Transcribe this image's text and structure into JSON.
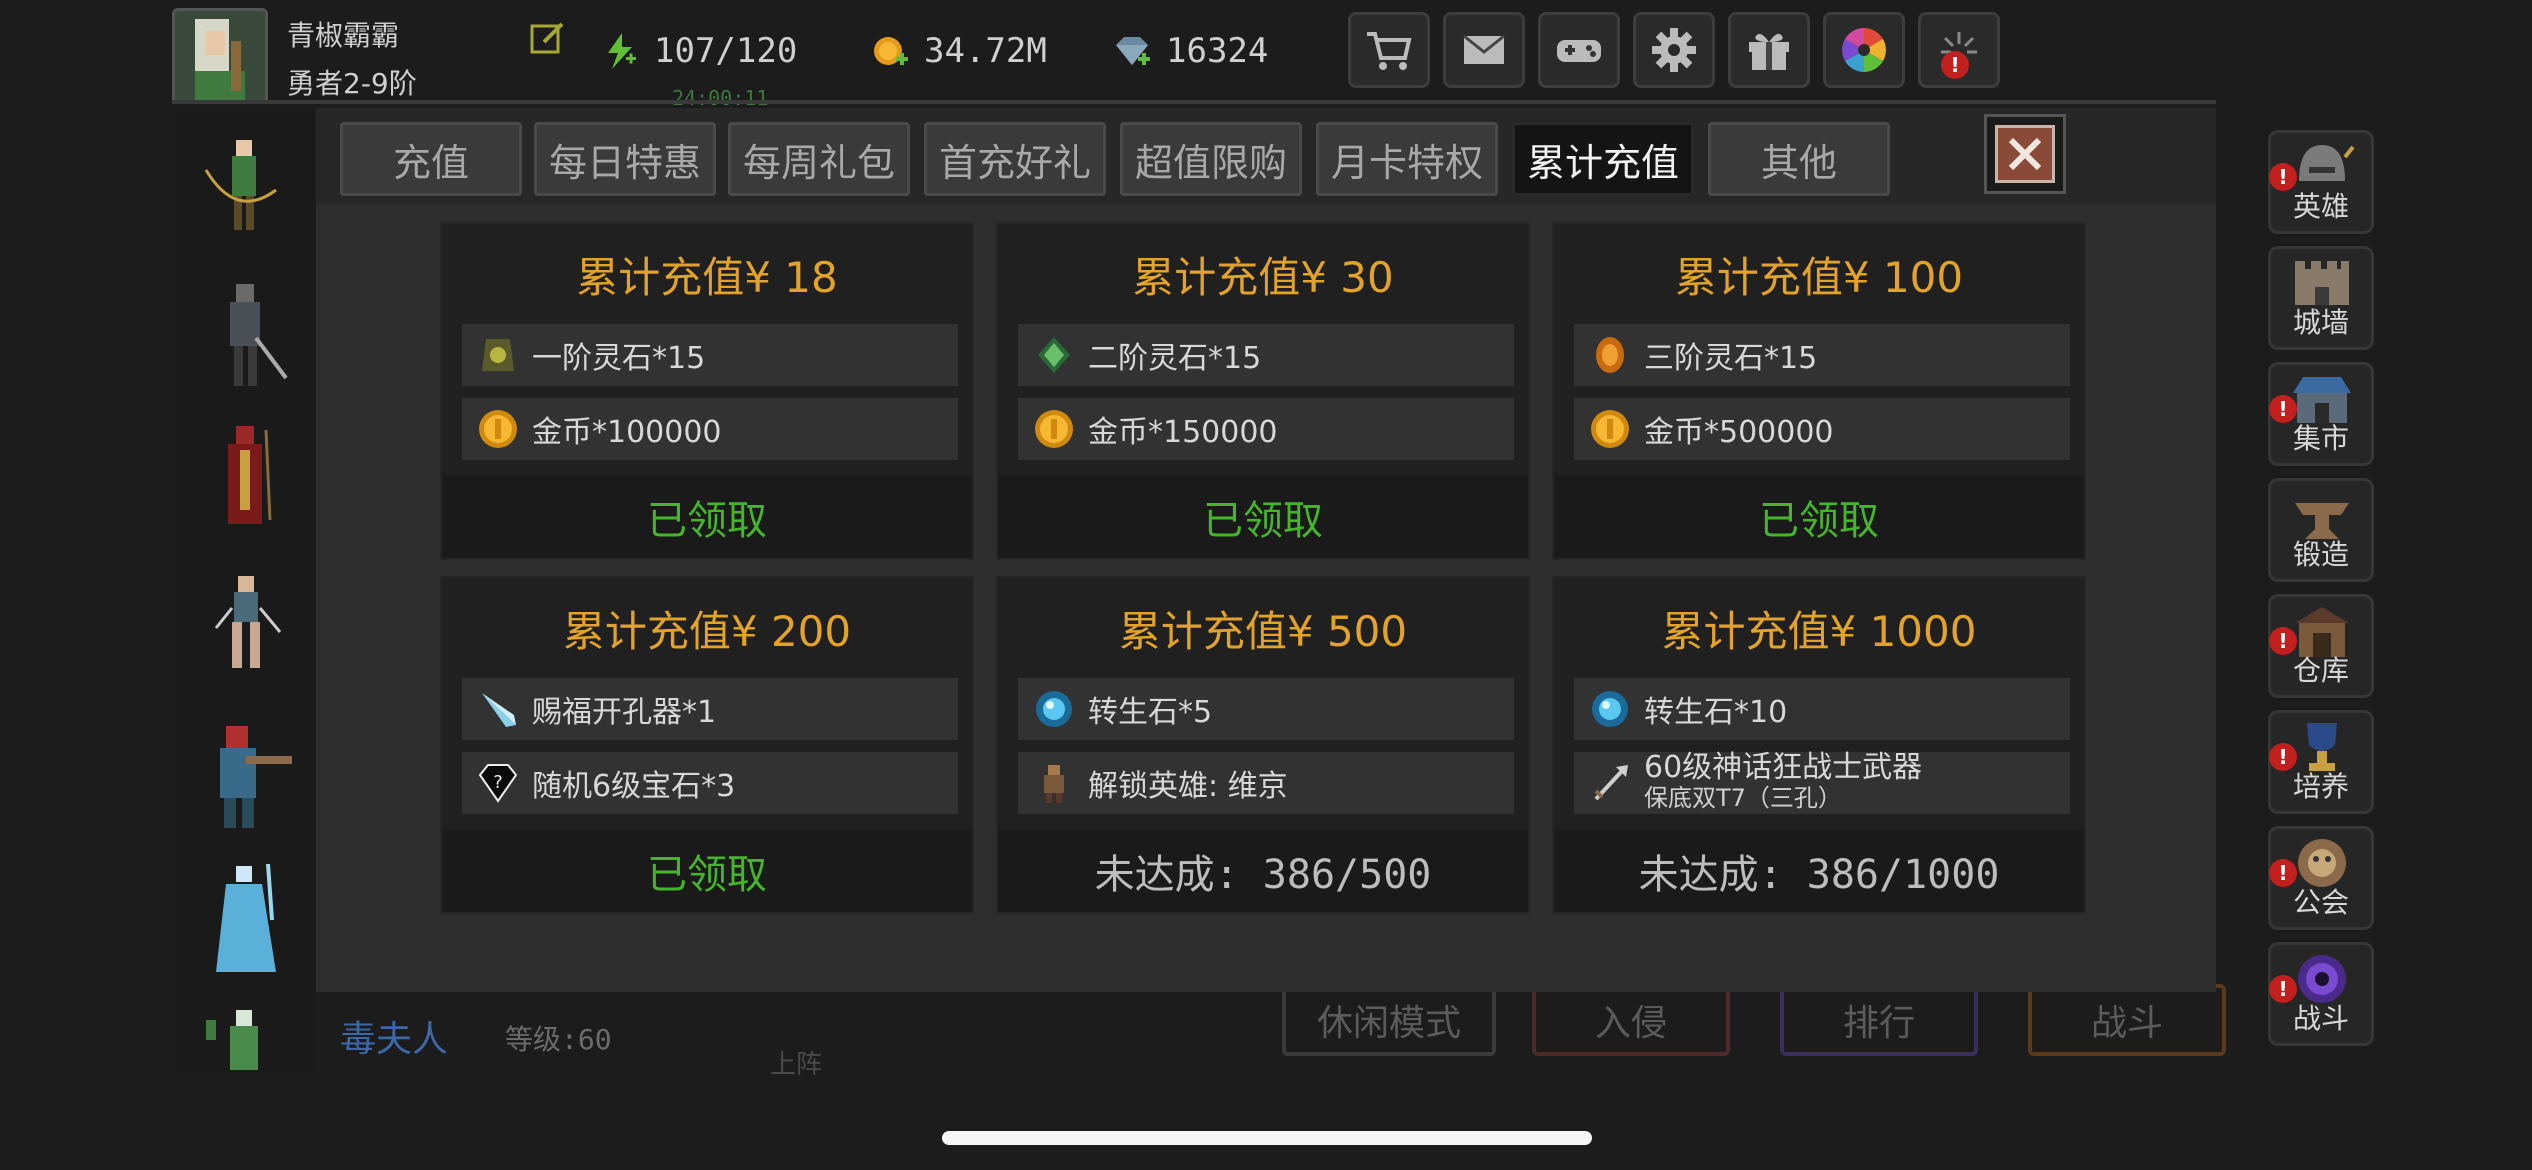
{
  "player": {
    "name": "青椒霸霸",
    "rank": "勇者2-9阶"
  },
  "resources": {
    "energy": "107/120",
    "energy_timer": "24:00:11",
    "gold": "34.72M",
    "gems": "16324"
  },
  "top_buttons": [
    {
      "name": "shop",
      "icon": "cart-icon"
    },
    {
      "name": "mail",
      "icon": "envelope-icon"
    },
    {
      "name": "gamepad",
      "icon": "gamepad-icon"
    },
    {
      "name": "settings",
      "icon": "gear-icon"
    },
    {
      "name": "gift",
      "icon": "gift-icon"
    },
    {
      "name": "wheel",
      "icon": "color-wheel-icon"
    },
    {
      "name": "fireworks",
      "icon": "fireworks-icon",
      "badge": "!"
    }
  ],
  "tabs": [
    {
      "label": "充值",
      "active": false
    },
    {
      "label": "每日特惠",
      "active": false
    },
    {
      "label": "每周礼包",
      "active": false
    },
    {
      "label": "首充好礼",
      "active": false
    },
    {
      "label": "超值限购",
      "active": false
    },
    {
      "label": "月卡特权",
      "active": false
    },
    {
      "label": "累计充值",
      "active": true
    },
    {
      "label": "其他",
      "active": false
    }
  ],
  "cards": [
    {
      "title": "累计充值¥ 18",
      "rewards": [
        {
          "icon": "tier1-spirit-stone-icon",
          "text": "一阶灵石*15"
        },
        {
          "icon": "gold-coin-icon",
          "text": "金币*100000"
        }
      ],
      "status": "已领取",
      "claimed": true
    },
    {
      "title": "累计充值¥ 30",
      "rewards": [
        {
          "icon": "tier2-spirit-stone-icon",
          "text": "二阶灵石*15"
        },
        {
          "icon": "gold-coin-icon",
          "text": "金币*150000"
        }
      ],
      "status": "已领取",
      "claimed": true
    },
    {
      "title": "累计充值¥ 100",
      "rewards": [
        {
          "icon": "tier3-spirit-stone-icon",
          "text": "三阶灵石*15"
        },
        {
          "icon": "gold-coin-icon",
          "text": "金币*500000"
        }
      ],
      "status": "已领取",
      "claimed": true
    },
    {
      "title": "累计充值¥ 200",
      "rewards": [
        {
          "icon": "socket-drill-icon",
          "text": "赐福开孔器*1"
        },
        {
          "icon": "random-gem-icon",
          "text": "随机6级宝石*3"
        }
      ],
      "status": "已领取",
      "claimed": true
    },
    {
      "title": "累计充值¥ 500",
      "rewards": [
        {
          "icon": "rebirth-stone-icon",
          "text": "转生石*5"
        },
        {
          "icon": "hero-unlock-icon",
          "text": "解锁英雄: 维京"
        }
      ],
      "status": "未达成: 386/500",
      "claimed": false
    },
    {
      "title": "累计充值¥ 1000",
      "rewards": [
        {
          "icon": "rebirth-stone-icon",
          "text": "转生石*10"
        },
        {
          "icon": "weapon-icon",
          "text": "60级神话狂战士武器",
          "sub": "保底双T7（三孔）"
        }
      ],
      "status": "未达成: 386/1000",
      "claimed": false
    }
  ],
  "right_menu": [
    {
      "label": "英雄",
      "icon": "helmet-icon",
      "badge": "!"
    },
    {
      "label": "城墙",
      "icon": "wall-icon"
    },
    {
      "label": "集市",
      "icon": "market-icon",
      "badge": "!"
    },
    {
      "label": "锻造",
      "icon": "anvil-icon"
    },
    {
      "label": "仓库",
      "icon": "warehouse-icon",
      "badge": "!"
    },
    {
      "label": "培养",
      "icon": "trophy-icon",
      "badge": "!"
    },
    {
      "label": "公会",
      "icon": "guild-icon",
      "badge": "!"
    },
    {
      "label": "战斗",
      "icon": "portal-icon",
      "badge": "!"
    }
  ],
  "background": {
    "hero_name": "毒夫人",
    "hero_level": "等级:60",
    "sub_label": "上阵",
    "buttons": [
      "休闲模式",
      "入侵",
      "排行",
      "战斗"
    ]
  },
  "colors": {
    "title_gold": "#e3a32a",
    "claimed_green": "#45b52c",
    "badge_red": "#c21f1f"
  }
}
